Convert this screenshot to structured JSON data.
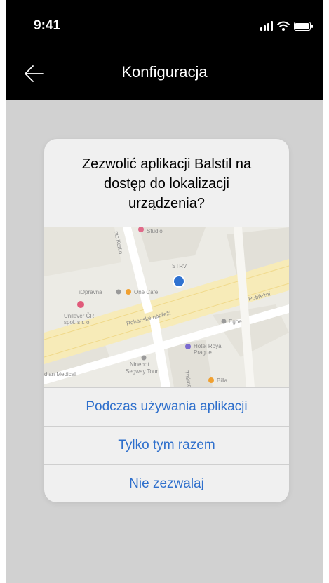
{
  "status_bar": {
    "time": "9:41",
    "icons": [
      "signal-icon",
      "wifi-icon",
      "battery-icon"
    ]
  },
  "header": {
    "title": "Konfiguracja",
    "back_icon": "arrow-left-icon"
  },
  "dialog": {
    "title_line1": "Zezwolić aplikacji Balstil na",
    "title_line2": "dostęp do lokalizacji",
    "title_line3": "urządzenia?",
    "buttons": {
      "while_using": "Podczas używania aplikacji",
      "once": "Tylko tym razem",
      "deny": "Nie zezwalaj"
    }
  },
  "map": {
    "labels": {
      "studio": "Studio",
      "strv": "STRV",
      "opravna": "iOpravna",
      "one_cafe": "One Cafe",
      "unilever": "Unilever ČR",
      "unilever2": "spol. s r. o.",
      "rohanske": "Rohanské nábřeží",
      "podrazsu": "Pobřežní",
      "egoe": "Egoe",
      "hotel": "Hotel Royal",
      "hotel2": "Prague",
      "ninebot": "Ninebot",
      "ninebot2": "Segway Tour",
      "dian": "dian Medical",
      "billa": "Billa",
      "thamova": "Thámova",
      "karlinske": "nic Karlín"
    }
  },
  "colors": {
    "accent": "#2e6fcc",
    "header_bg": "#000000",
    "screen_bg": "#d1d1d1",
    "pin": "#2f72d1"
  }
}
